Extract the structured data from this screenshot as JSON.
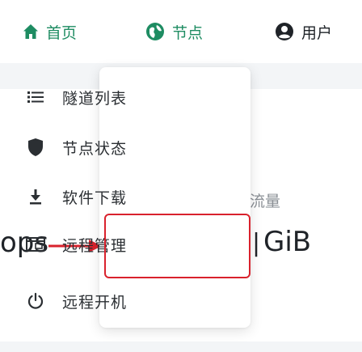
{
  "nav": {
    "home_label": "首页",
    "node_label": "节点",
    "user_label": "用户"
  },
  "menu": {
    "items": [
      {
        "label": "隧道列表",
        "icon": "list-icon"
      },
      {
        "label": "节点状态",
        "icon": "shield-icon"
      },
      {
        "label": "软件下载",
        "icon": "download-icon"
      },
      {
        "label": "远程管理",
        "icon": "remote-window-icon"
      },
      {
        "label": "远程开机",
        "icon": "power-icon"
      }
    ]
  },
  "background": {
    "flow_label": "流量",
    "side_text": "ops",
    "unit_text": "GiB",
    "separator": "|"
  },
  "colors": {
    "nav_active": "#1e8c62",
    "highlight": "#d9222d",
    "text": "#2b2f33"
  }
}
